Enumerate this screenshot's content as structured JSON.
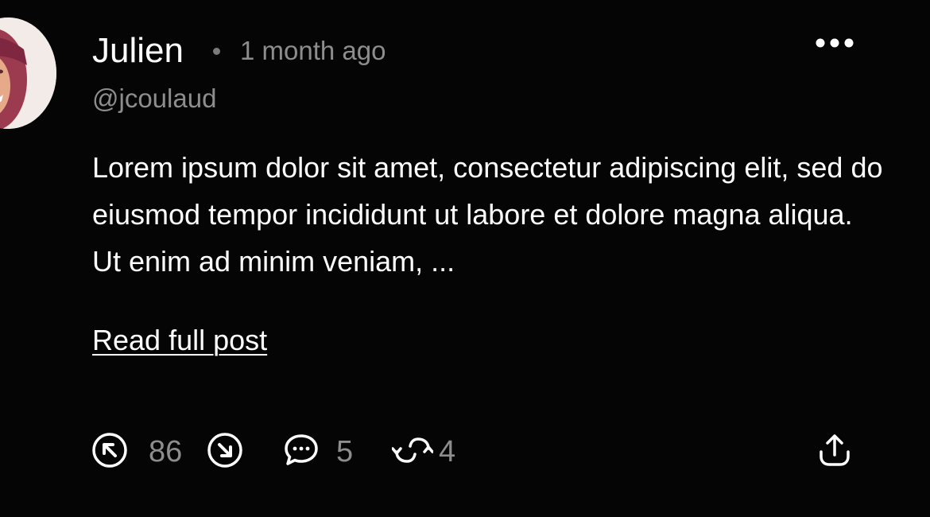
{
  "post": {
    "author_name": "Julien",
    "timestamp": "1 month ago",
    "handle": "@jcoulaud",
    "body": "Lorem ipsum dolor sit amet, consectetur adipiscing elit, sed do eiusmod tempor incididunt ut labore et dolore magna aliqua. Ut enim ad minim veniam, ...",
    "read_more_label": "Read full post"
  },
  "actions": {
    "vote_count": "86",
    "comment_count": "5",
    "repost_count": "4"
  },
  "icons": {
    "more": "more-horizontal-icon",
    "upvote": "arrow-up-left-circle-icon",
    "downvote": "arrow-down-right-circle-icon",
    "comment": "chat-bubble-icon",
    "repost": "repost-arrows-icon",
    "share": "share-upload-icon"
  },
  "colors": {
    "background": "#000000",
    "primary_text": "#ffffff",
    "secondary_text": "#8d8d8d"
  }
}
